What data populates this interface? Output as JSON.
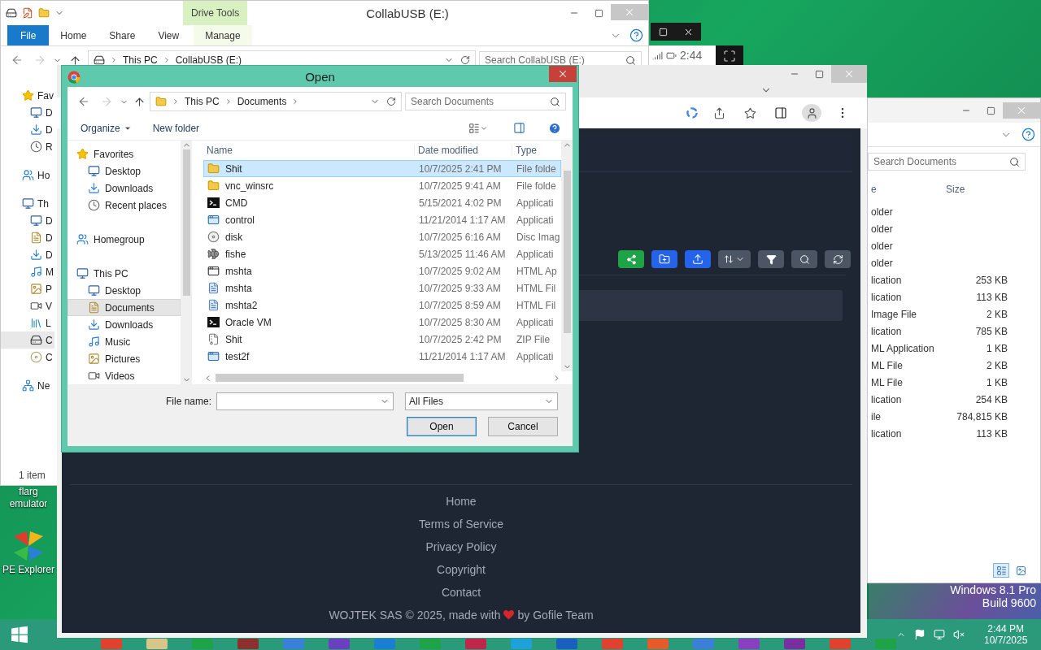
{
  "desktop": {
    "icons": [
      {
        "label": "flarg emulator",
        "kind": "plain"
      },
      {
        "label": "PE Explorer",
        "kind": "app"
      }
    ],
    "os_edition": "Windows 8.1 Pro",
    "os_build": "Build 9600"
  },
  "explorer": {
    "context_tab": "Drive Tools",
    "title": "CollabUSB (E:)",
    "ribbon_tabs": [
      {
        "label": "File",
        "kind": "file"
      },
      {
        "label": "Home",
        "kind": "tab"
      },
      {
        "label": "Share",
        "kind": "tab"
      },
      {
        "label": "View",
        "kind": "tab"
      },
      {
        "label": "Manage",
        "kind": "context"
      }
    ],
    "path": [
      "This PC",
      "CollabUSB (E:)"
    ],
    "search": {
      "placeholder": "Search CollabUSB (E:)"
    },
    "nav": [
      {
        "label": "Fav",
        "kind": "star",
        "selected": false,
        "children": [
          {
            "label": "D",
            "kind": "desktop",
            "selected": false
          },
          {
            "label": "D",
            "kind": "downloads",
            "selected": false
          },
          {
            "label": "R",
            "kind": "recent",
            "selected": false
          }
        ]
      },
      {
        "label": "Ho",
        "kind": "homegroup",
        "selected": false
      },
      {
        "label": "Th",
        "kind": "pc",
        "selected": false,
        "children": [
          {
            "label": "D",
            "kind": "desktop",
            "selected": false
          },
          {
            "label": "D",
            "kind": "documents",
            "selected": false
          },
          {
            "label": "D",
            "kind": "downloads",
            "selected": false
          },
          {
            "label": "M",
            "kind": "music",
            "selected": false
          },
          {
            "label": "P",
            "kind": "pictures",
            "selected": false
          },
          {
            "label": "V",
            "kind": "videos",
            "selected": false
          },
          {
            "label": "L",
            "kind": "drive",
            "selected": false
          },
          {
            "label": "C",
            "kind": "usb",
            "selected": true
          },
          {
            "label": "C",
            "kind": "disc",
            "selected": false
          }
        ]
      },
      {
        "label": "Ne",
        "kind": "network",
        "selected": false
      }
    ],
    "status": "1 item"
  },
  "remote_bar": {
    "time": "2:44"
  },
  "back_window": {
    "search": {
      "placeholder": "Search Documents"
    },
    "columns": [
      "e",
      "Size"
    ],
    "rows": [
      {
        "type": "older"
      },
      {
        "type": "older"
      },
      {
        "type": "older"
      },
      {
        "type": "older"
      },
      {
        "type": "lication",
        "size": "253 KB"
      },
      {
        "type": "lication",
        "size": "113 KB"
      },
      {
        "type": "Image File",
        "size": "2 KB"
      },
      {
        "type": "lication",
        "size": "785 KB"
      },
      {
        "type": "ML Application",
        "size": "1 KB"
      },
      {
        "type": "ML File",
        "size": "2 KB"
      },
      {
        "type": "ML File",
        "size": "1 KB"
      },
      {
        "type": "lication",
        "size": "254 KB"
      },
      {
        "type": "ile",
        "size": "784,815 KB"
      },
      {
        "type": "lication",
        "size": "113 KB"
      }
    ]
  },
  "browser": {
    "footer_links": [
      "Home",
      "Terms of Service",
      "Privacy Policy",
      "Copyright",
      "Contact"
    ],
    "credit_before": "WOJTEK SAS © 2025, made with",
    "credit_after": "by Gofile Team"
  },
  "dialog": {
    "title": "Open",
    "path": [
      "This PC",
      "Documents"
    ],
    "search": {
      "placeholder": "Search Documents"
    },
    "commands": [
      "Organize",
      "New folder"
    ],
    "nav": [
      {
        "label": "Favorites",
        "kind": "star",
        "selected": false,
        "children": [
          {
            "label": "Desktop",
            "kind": "desktop",
            "selected": false
          },
          {
            "label": "Downloads",
            "kind": "downloads",
            "selected": false
          },
          {
            "label": "Recent places",
            "kind": "recent",
            "selected": false
          }
        ]
      },
      {
        "label": "Homegroup",
        "kind": "homegroup",
        "selected": false
      },
      {
        "label": "This PC",
        "kind": "pc",
        "selected": false,
        "children": [
          {
            "label": "Desktop",
            "kind": "desktop",
            "selected": false
          },
          {
            "label": "Documents",
            "kind": "documents",
            "selected": true
          },
          {
            "label": "Downloads",
            "kind": "downloads",
            "selected": false
          },
          {
            "label": "Music",
            "kind": "music",
            "selected": false
          },
          {
            "label": "Pictures",
            "kind": "pictures",
            "selected": false
          },
          {
            "label": "Videos",
            "kind": "videos",
            "selected": false
          }
        ]
      }
    ],
    "columns": [
      "Name",
      "Date modified",
      "Type"
    ],
    "rows": [
      {
        "name": "Shit",
        "date": "10/7/2025 2:41 PM",
        "type": "File folde",
        "kind": "folder",
        "selected": true
      },
      {
        "name": "vnc_winsrc",
        "date": "10/7/2025 9:41 AM",
        "type": "File folde",
        "kind": "folder",
        "selected": false
      },
      {
        "name": "CMD",
        "date": "5/15/2021 4:02 PM",
        "type": "Applicati",
        "kind": "console",
        "selected": false
      },
      {
        "name": "control",
        "date": "11/21/2014 1:17 AM",
        "type": "Applicati",
        "kind": "app",
        "selected": false
      },
      {
        "name": "disk",
        "date": "10/7/2025 6:16 AM",
        "type": "Disc Imag",
        "kind": "disc",
        "selected": false
      },
      {
        "name": "fishe",
        "date": "5/13/2025 11:46 AM",
        "type": "Applicati",
        "kind": "fish",
        "selected": false
      },
      {
        "name": "mshta",
        "date": "10/7/2025 9:02 AM",
        "type": "HTML Ap",
        "kind": "window",
        "selected": false
      },
      {
        "name": "mshta",
        "date": "10/7/2025 9:33 AM",
        "type": "HTML Fil",
        "kind": "html",
        "selected": false
      },
      {
        "name": "mshta2",
        "date": "10/7/2025 8:59 AM",
        "type": "HTML Fil",
        "kind": "html",
        "selected": false
      },
      {
        "name": "Oracle VM",
        "date": "10/7/2025 8:30 AM",
        "type": "Applicati",
        "kind": "console",
        "selected": false
      },
      {
        "name": "Shit",
        "date": "10/7/2025 2:42 PM",
        "type": "ZIP File",
        "kind": "zip",
        "selected": false
      },
      {
        "name": "test2f",
        "date": "11/21/2014 1:17 AM",
        "type": "Applicati",
        "kind": "app",
        "selected": false
      }
    ],
    "file_name_label": "File name:",
    "filter": "All Files",
    "buttons": [
      {
        "label": "Open",
        "kind": "default"
      },
      {
        "label": "Cancel",
        "kind": "normal"
      }
    ]
  },
  "taskbar": {
    "time": "2:44 PM",
    "date": "10/7/2025"
  }
}
